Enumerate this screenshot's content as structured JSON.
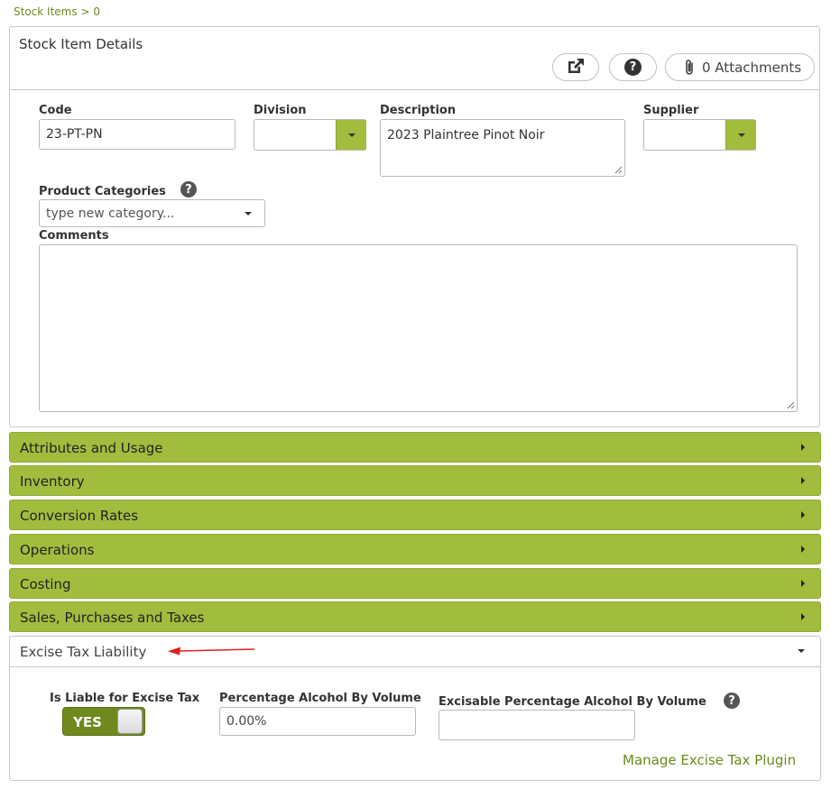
{
  "breadcrumb": {
    "parent": "Stock Items",
    "separator": ">",
    "current": "0"
  },
  "panel": {
    "title": "Stock Item Details",
    "toolbar": {
      "open_icon": "external-link-icon",
      "help_icon": "question-circle-icon",
      "attachments_label": "0 Attachments",
      "attachments_icon": "paperclip-icon"
    }
  },
  "fields": {
    "code": {
      "label": "Code",
      "value": "23-PT-PN"
    },
    "division": {
      "label": "Division",
      "value": ""
    },
    "description": {
      "label": "Description",
      "value": "2023 Plaintree Pinot Noir"
    },
    "supplier": {
      "label": "Supplier",
      "value": ""
    },
    "product_categories": {
      "label": "Product Categories",
      "placeholder": "type new category..."
    },
    "comments": {
      "label": "Comments",
      "value": ""
    }
  },
  "sections": [
    {
      "label": "Attributes and Usage"
    },
    {
      "label": "Inventory"
    },
    {
      "label": "Conversion Rates"
    },
    {
      "label": "Operations"
    },
    {
      "label": "Costing"
    },
    {
      "label": "Sales, Purchases and Taxes"
    }
  ],
  "excise": {
    "title": "Excise Tax Liability",
    "liable_label": "Is Liable for Excise Tax",
    "liable_value": "YES",
    "abv_label": "Percentage Alcohol By Volume",
    "abv_value": "0.00%",
    "excisable_label": "Excisable Percentage Alcohol By Volume",
    "excisable_value": "",
    "manage_link": "Manage Excise Tax Plugin"
  },
  "colors": {
    "accent": "#a2bd3e",
    "toggle": "#6e8a1f",
    "link": "#6a8a1c",
    "annotation_arrow": "#e02020"
  }
}
